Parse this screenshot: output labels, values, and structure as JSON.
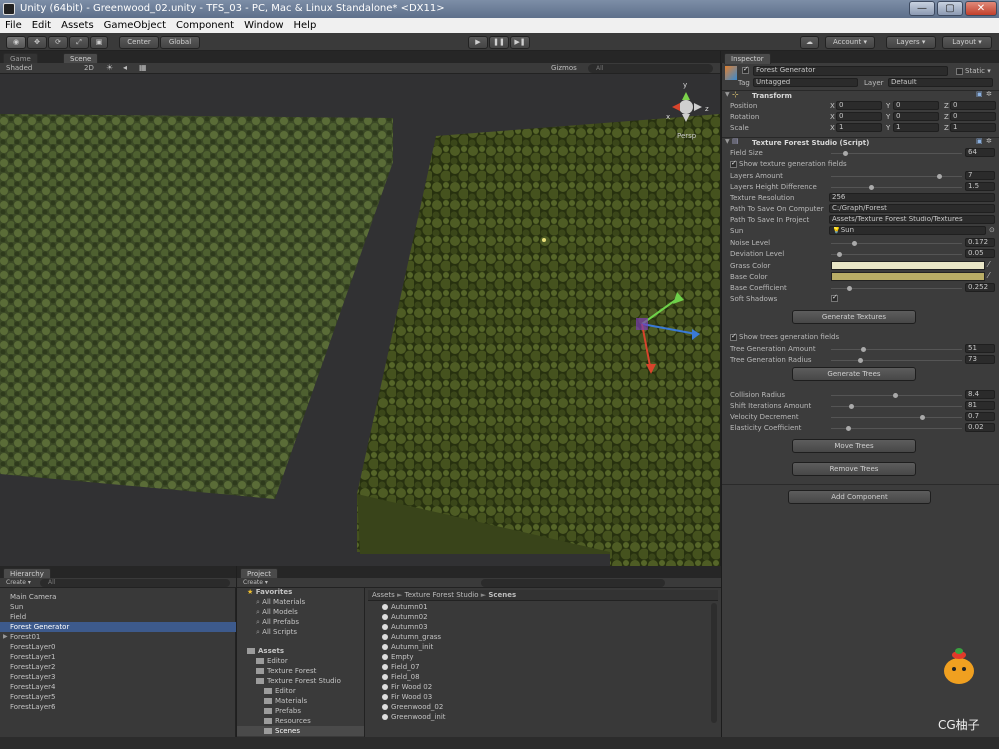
{
  "window": {
    "title": "Unity (64bit) - Greenwood_02.unity - TFS_03 - PC, Mac & Linux Standalone* <DX11>",
    "minimize": "—",
    "maximize": "▢",
    "close": "✕"
  },
  "menu": [
    "File",
    "Edit",
    "Assets",
    "GameObject",
    "Component",
    "Window",
    "Help"
  ],
  "toolbar": {
    "pivot": "Center",
    "space": "Global",
    "play": "▶",
    "pause": "❚❚",
    "step": "▶❚",
    "cloud": "☁",
    "account": "Account",
    "layers": "Layers",
    "layout": "Layout"
  },
  "scene": {
    "tab_game": "Game",
    "tab_scene": "Scene",
    "shading": "Shaded",
    "mode_2d": "2D",
    "gizmos": "Gizmos",
    "search_prefix": "All",
    "persp": "Persp"
  },
  "hierarchy": {
    "tab": "Hierarchy",
    "create": "Create",
    "search_prefix": "All",
    "items": [
      "Main Camera",
      "Sun",
      "Field",
      "Forest Generator",
      "Forest01",
      "ForestLayer0",
      "ForestLayer1",
      "ForestLayer2",
      "ForestLayer3",
      "ForestLayer4",
      "ForestLayer5",
      "ForestLayer6"
    ]
  },
  "project": {
    "tab": "Project",
    "create": "Create",
    "favorites": {
      "label": "Favorites",
      "items": [
        "All Materials",
        "All Models",
        "All Prefabs",
        "All Scripts"
      ]
    },
    "assets": {
      "label": "Assets",
      "items": [
        "Editor",
        "Texture Forest",
        "Texture Forest Studio"
      ],
      "sub_items": [
        "Editor",
        "Materials",
        "Prefabs",
        "Resources",
        "Scenes"
      ]
    },
    "breadcrumb": [
      "Assets",
      "Texture Forest Studio",
      "Scenes"
    ],
    "breadcrumb_sep": "►",
    "files": [
      "Autumn01",
      "Autumn02",
      "Autumn03",
      "Autumn_grass",
      "Autumn_init",
      "Empty",
      "Field_07",
      "Field_08",
      "Fir Wood 02",
      "Fir Wood 03",
      "Greenwood_02",
      "Greenwood_init"
    ]
  },
  "inspector": {
    "tab": "Inspector",
    "object_name": "Forest Generator",
    "static_label": "Static",
    "tag_label": "Tag",
    "tag_value": "Untagged",
    "layer_label": "Layer",
    "layer_value": "Default",
    "transform": {
      "title": "Transform",
      "rows": [
        {
          "label": "Position",
          "x": "0",
          "y": "0",
          "z": "0"
        },
        {
          "label": "Rotation",
          "x": "0",
          "y": "0",
          "z": "0"
        },
        {
          "label": "Scale",
          "x": "1",
          "y": "1",
          "z": "1"
        }
      ],
      "x_label": "X",
      "y_label": "Y",
      "z_label": "Z"
    },
    "script": {
      "title": "Texture Forest Studio (Script)",
      "field_size_label": "Field Size",
      "field_size_value": "64",
      "show_texture_fields": "Show texture generation fields",
      "layers_amount_label": "Layers Amount",
      "layers_amount_value": "7",
      "layers_height_label": "Layers Height Difference",
      "layers_height_value": "1.5",
      "texture_resolution_label": "Texture Resolution",
      "texture_resolution_value": "256",
      "path_computer_label": "Path To Save On Computer",
      "path_computer_value": "C:/Graph/Forest",
      "path_project_label": "Path To Save In Project",
      "path_project_value": "Assets/Texture Forest Studio/Textures",
      "sun_label": "Sun",
      "sun_value": "Sun",
      "noise_label": "Noise Level",
      "noise_value": "0.172",
      "deviation_label": "Deviation Level",
      "deviation_value": "0.05",
      "grass_color_label": "Grass Color",
      "base_color_label": "Base Color",
      "base_coef_label": "Base Coefficient",
      "base_coef_value": "0.252",
      "soft_shadows_label": "Soft Shadows",
      "generate_textures": "Generate Textures",
      "show_trees_fields": "Show trees generation fields",
      "tree_amount_label": "Tree Generation Amount",
      "tree_amount_value": "51",
      "tree_radius_label": "Tree Generation Radius",
      "tree_radius_value": "73",
      "generate_trees": "Generate Trees",
      "collision_label": "Collision Radius",
      "collision_value": "8.4",
      "shift_label": "Shift Iterations Amount",
      "shift_value": "81",
      "velocity_label": "Velocity Decrement",
      "velocity_value": "0.7",
      "elasticity_label": "Elasticity Coefficient",
      "elasticity_value": "0.02",
      "move_trees": "Move Trees",
      "remove_trees": "Remove Trees"
    },
    "add_component": "Add Component"
  },
  "watermark": "CG柚子",
  "colors": {
    "grass": "#e9e6c6",
    "base": "#b9ad66",
    "forest_dark": "#2f3f1c",
    "forest_light": "#52642c"
  }
}
